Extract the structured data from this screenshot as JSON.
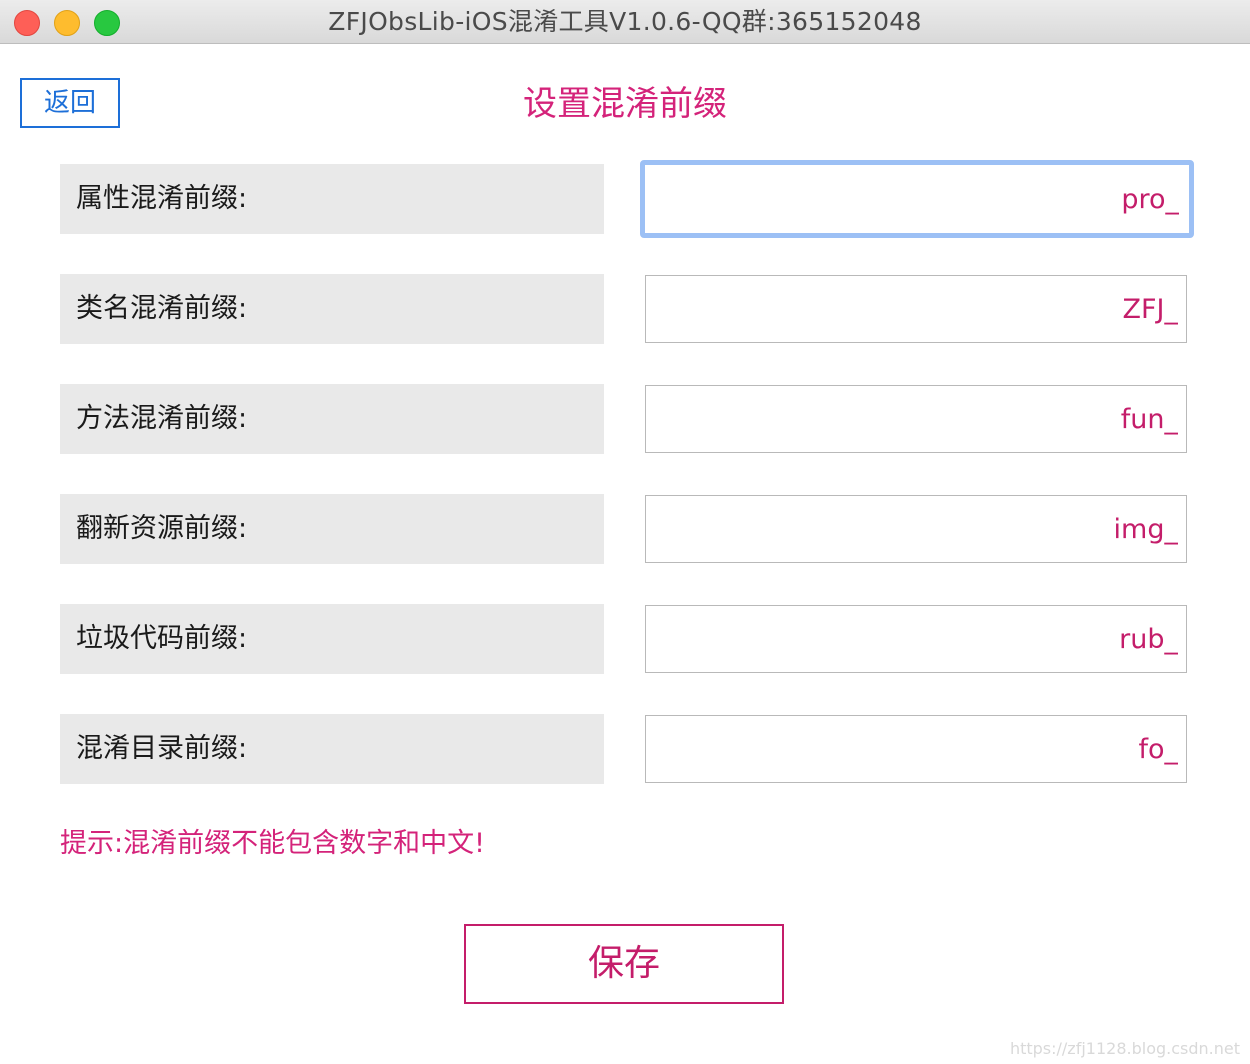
{
  "window": {
    "title": "ZFJObsLib-iOS混淆工具V1.0.6-QQ群:365152048"
  },
  "header": {
    "back_label": "返回",
    "page_title": "设置混淆前缀"
  },
  "rows": [
    {
      "label": "属性混淆前缀:",
      "value": "pro_",
      "focused": true
    },
    {
      "label": "类名混淆前缀:",
      "value": "ZFJ_"
    },
    {
      "label": "方法混淆前缀:",
      "value": "fun_"
    },
    {
      "label": "翻新资源前缀:",
      "value": "img_"
    },
    {
      "label": "垃圾代码前缀:",
      "value": "rub_"
    },
    {
      "label": "混淆目录前缀:",
      "value": "fo_"
    }
  ],
  "hint": "提示:混淆前缀不能包含数字和中文!",
  "save_label": "保存",
  "watermark": "https://zfj1128.blog.csdn.net",
  "colors": {
    "accent_pink": "#d4237a",
    "value_pink": "#c41d6a",
    "back_blue": "#1d6fd8",
    "focus_ring": "#9cc0f5",
    "label_bg": "#e9e9e9"
  }
}
